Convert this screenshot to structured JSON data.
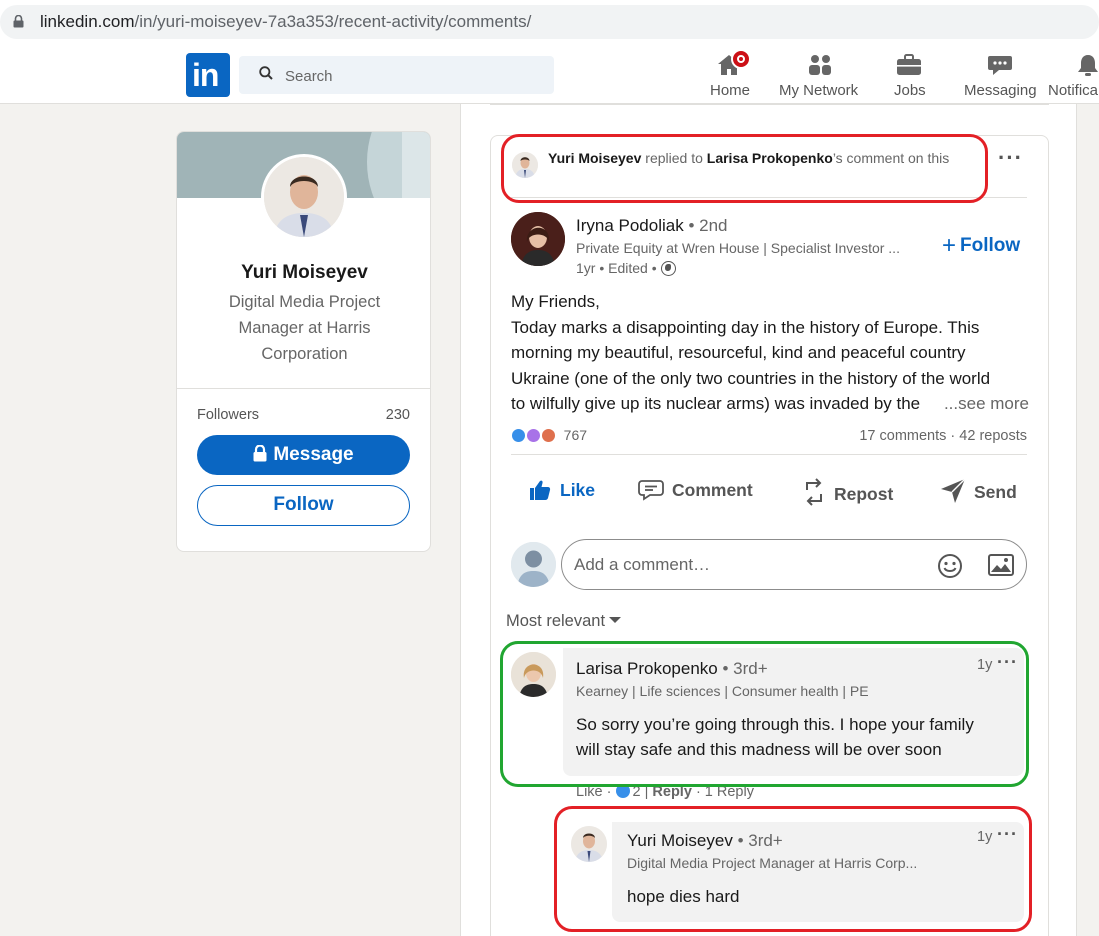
{
  "browser": {
    "url_host": "linkedin.com",
    "url_path": "/in/yuri-moiseyev-7a3a353/recent-activity/comments/"
  },
  "nav": {
    "logo": "in",
    "search_placeholder": "Search",
    "items": [
      {
        "label": "Home",
        "icon": "home-icon",
        "notification_badge": true
      },
      {
        "label": "My Network",
        "icon": "network-icon"
      },
      {
        "label": "Jobs",
        "icon": "briefcase-icon"
      },
      {
        "label": "Messaging",
        "icon": "messaging-icon"
      },
      {
        "label": "Notifica",
        "icon": "bell-icon"
      }
    ]
  },
  "profile": {
    "name": "Yuri Moiseyev",
    "title": "Digital Media Project Manager at Harris Corporation",
    "followers_label": "Followers",
    "followers_count": "230",
    "message_label": "Message",
    "follow_label": "Follow"
  },
  "post": {
    "context": {
      "actor": "Yuri Moiseyev",
      "verb": "replied to",
      "target": "Larisa Prokopenko",
      "suffix": "’s comment on this"
    },
    "author": {
      "name": "Iryna Podoliak",
      "degree": "• 2nd",
      "headline": "Private Equity at Wren House | Specialist Investor ...",
      "meta": "1yr • Edited •"
    },
    "follow_label": "Follow",
    "body_lines": [
      "My Friends,",
      "Today marks a disappointing day in the history of Europe. This",
      "morning my beautiful, resourceful, kind and peaceful country",
      "Ukraine (one of the only two countries in the history of the world",
      "to wilfully give up its nuclear arms) was invaded by the"
    ],
    "see_more": "...see more",
    "reactions_count": "767",
    "comments_reposts": "17 comments · 42 reposts",
    "actions": [
      "Like",
      "Comment",
      "Repost",
      "Send"
    ],
    "comment_placeholder": "Add a comment…",
    "sort_label": "Most relevant"
  },
  "comments": [
    {
      "name": "Larisa Prokopenko",
      "degree": "• 3rd+",
      "headline": "Kearney | Life sciences | Consumer health | PE",
      "time": "1y",
      "text_lines": [
        "So sorry you’re going through this. I hope your family",
        "will stay safe and this madness will be over soon"
      ],
      "like_label": "Like",
      "like_count": "2",
      "reply_label": "Reply",
      "replies_label": "1 Reply"
    },
    {
      "name": "Yuri Moiseyev",
      "degree": "• 3rd+",
      "headline": "Digital Media Project Manager at Harris Corp...",
      "time": "1y",
      "text_lines": [
        "hope dies hard"
      ]
    }
  ],
  "colors": {
    "brand": "#0a66c2",
    "annotation_red": "#e32026",
    "annotation_green": "#21a631",
    "notification": "#cc1016"
  }
}
